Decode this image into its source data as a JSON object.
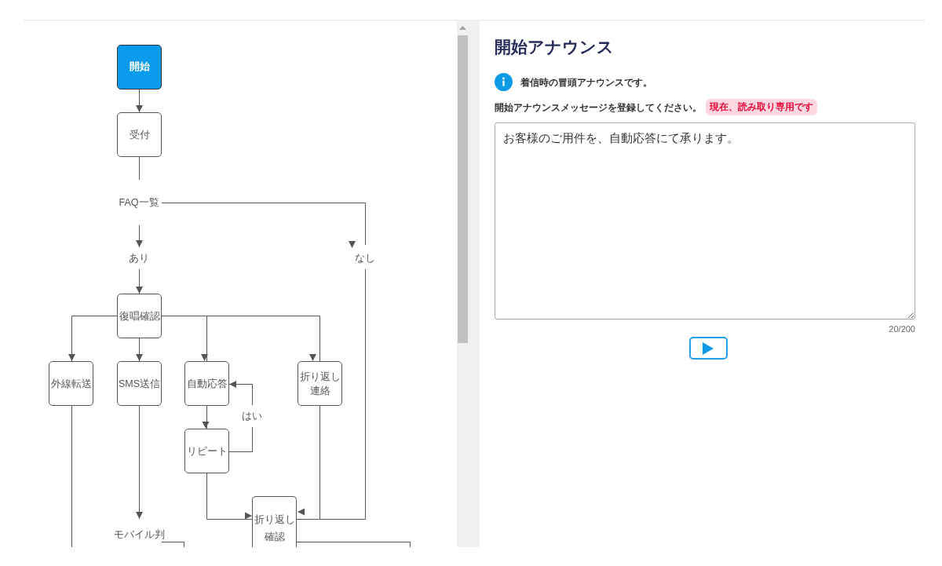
{
  "flowchart": {
    "nodes": [
      {
        "label": "開始",
        "kind": "step",
        "selected": true
      },
      {
        "label": "受付",
        "kind": "step",
        "selected": false
      },
      {
        "label": "FAQ一覧",
        "kind": "label",
        "selected": false
      },
      {
        "label": "あり",
        "kind": "label",
        "selected": false
      },
      {
        "label": "なし",
        "kind": "label",
        "selected": false
      },
      {
        "label": "復唱確認",
        "kind": "step",
        "selected": false
      },
      {
        "label": "外線転送",
        "kind": "step",
        "selected": false
      },
      {
        "label": "SMS送信",
        "kind": "step",
        "selected": false
      },
      {
        "label": "自動応答",
        "kind": "step",
        "selected": false
      },
      {
        "label": "はい",
        "kind": "label",
        "selected": false
      },
      {
        "label": "折り返し連絡",
        "kind": "step",
        "selected": false
      },
      {
        "label": "リピート",
        "kind": "step",
        "selected": false
      },
      {
        "label": "モバイル判",
        "kind": "label",
        "selected": false
      },
      {
        "label": "折り返し確認",
        "kind": "step",
        "selected": false
      }
    ]
  },
  "panel": {
    "title": "開始アナウンス",
    "info": "着信時の冒頭アナウンスです。",
    "instruction": "開始アナウンスメッセージを登録してください。",
    "badge": "現在、読み取り専用です",
    "message": {
      "value": "お客様のご用件を、自動応答にて承ります。",
      "counter": "20/200"
    }
  }
}
